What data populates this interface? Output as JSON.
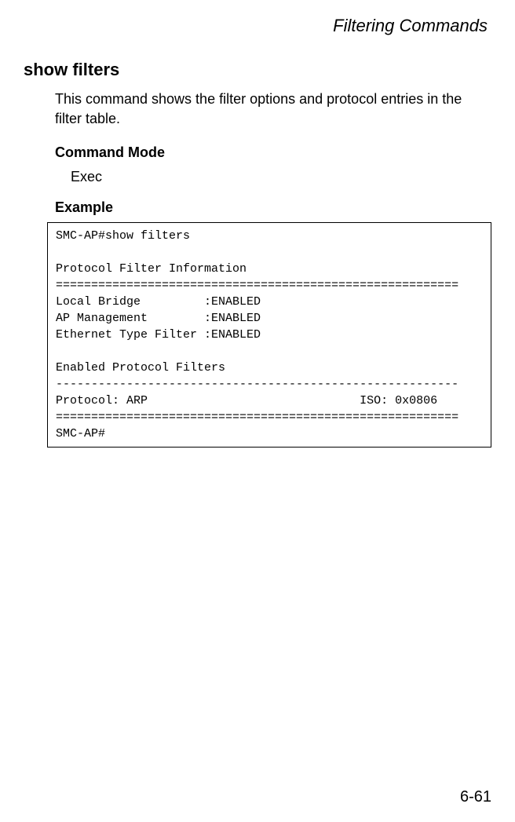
{
  "header": {
    "title": "Filtering Commands"
  },
  "section": {
    "title": "show filters",
    "description": "This command shows the filter options and protocol entries in the filter table.",
    "commandModeLabel": "Command Mode",
    "commandModeValue": "Exec",
    "exampleLabel": "Example"
  },
  "codeBlock": {
    "content": "SMC-AP#show filters\n\nProtocol Filter Information\n=========================================================\nLocal Bridge         :ENABLED\nAP Management        :ENABLED\nEthernet Type Filter :ENABLED\n\nEnabled Protocol Filters\n---------------------------------------------------------\nProtocol: ARP                              ISO: 0x0806\n=========================================================\nSMC-AP#"
  },
  "footer": {
    "pageNumber": "6-61"
  }
}
